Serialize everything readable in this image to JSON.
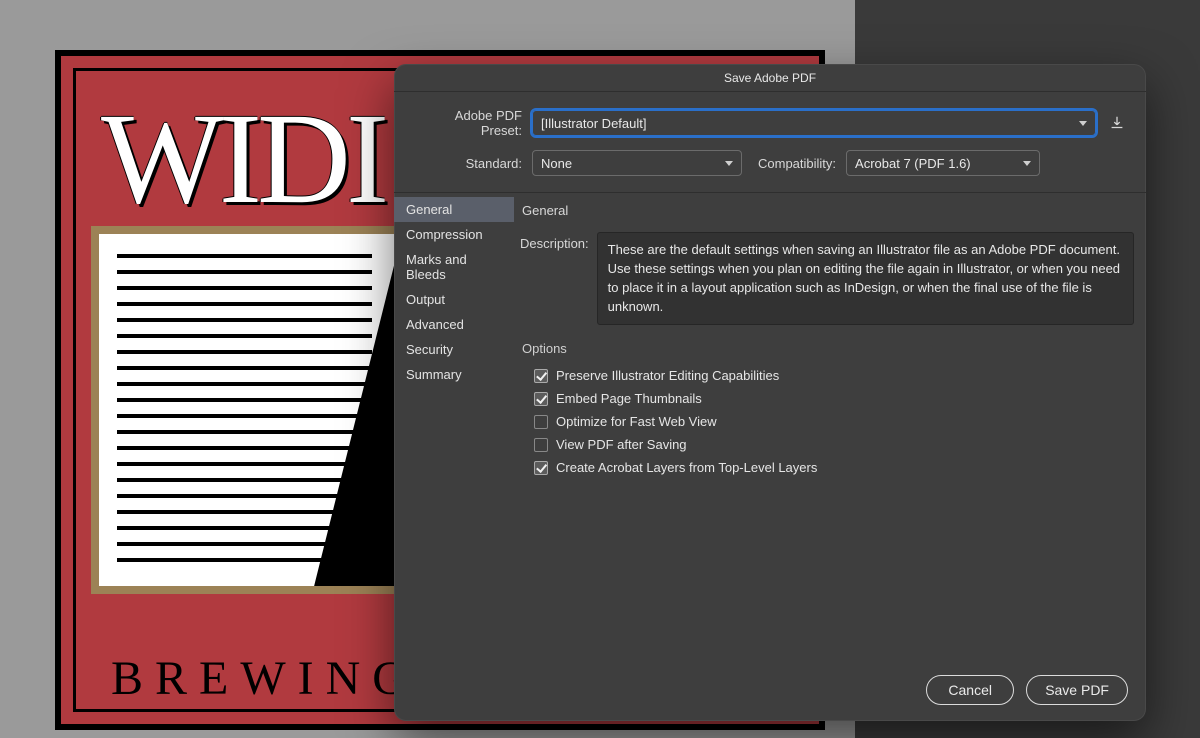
{
  "canvas": {
    "top_text": "WIDI",
    "bottom_text": "BREWING  C"
  },
  "dialog": {
    "title": "Save Adobe PDF",
    "preset_label": "Adobe PDF Preset:",
    "preset_value": "[Illustrator Default]",
    "standard_label": "Standard:",
    "standard_value": "None",
    "compat_label": "Compatibility:",
    "compat_value": "Acrobat 7 (PDF 1.6)",
    "sidebar": {
      "items": [
        "General",
        "Compression",
        "Marks and Bleeds",
        "Output",
        "Advanced",
        "Security",
        "Summary"
      ],
      "active_index": 0
    },
    "panel": {
      "heading": "General",
      "description_label": "Description:",
      "description": "These are the default settings when saving an Illustrator file as an Adobe PDF document. Use these settings when you plan on editing the file again in Illustrator, or when you need to place it in a layout application such as InDesign, or when the final use of the file is unknown.",
      "options_label": "Options",
      "options": [
        {
          "label": "Preserve Illustrator Editing Capabilities",
          "checked": true
        },
        {
          "label": "Embed Page Thumbnails",
          "checked": true
        },
        {
          "label": "Optimize for Fast Web View",
          "checked": false
        },
        {
          "label": "View PDF after Saving",
          "checked": false
        },
        {
          "label": "Create Acrobat Layers from Top-Level Layers",
          "checked": true
        }
      ]
    },
    "buttons": {
      "cancel": "Cancel",
      "save": "Save PDF"
    }
  }
}
